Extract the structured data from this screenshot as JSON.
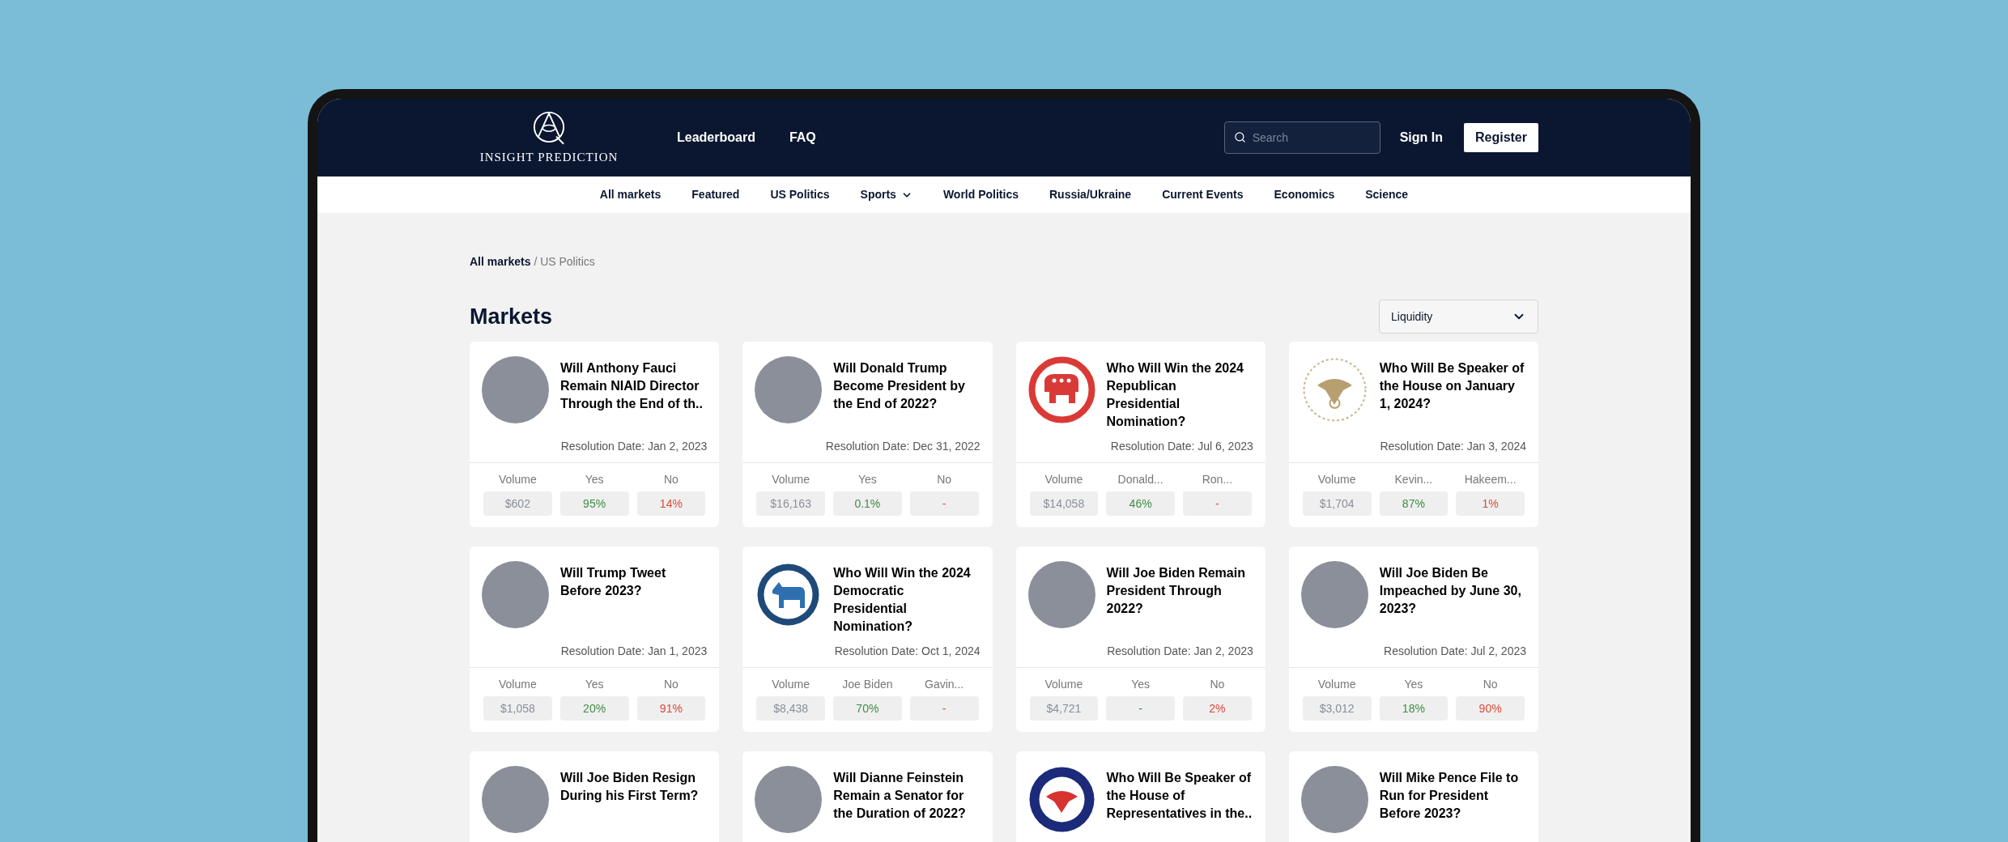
{
  "header": {
    "logo_text": "INSIGHT PREDICTION",
    "links": [
      "Leaderboard",
      "FAQ"
    ],
    "search": {
      "placeholder": "Search"
    },
    "sign_in": "Sign In",
    "register": "Register"
  },
  "nav": [
    {
      "label": "All markets",
      "dropdown": false
    },
    {
      "label": "Featured",
      "dropdown": false
    },
    {
      "label": "US Politics",
      "dropdown": false
    },
    {
      "label": "Sports",
      "dropdown": true
    },
    {
      "label": "World Politics",
      "dropdown": false
    },
    {
      "label": "Russia/Ukraine",
      "dropdown": false
    },
    {
      "label": "Current Events",
      "dropdown": false
    },
    {
      "label": "Economics",
      "dropdown": false
    },
    {
      "label": "Science",
      "dropdown": false
    }
  ],
  "breadcrumb": {
    "parent": "All markets",
    "current": "/ US Politics"
  },
  "title": "Markets",
  "sort": {
    "value": "Liquidity"
  },
  "markets": [
    {
      "kind": "photo",
      "title": "Will Anthony Fauci Remain NIAID Director Through the End of th..",
      "resolution": "Resolution Date: Jan 2, 2023",
      "stats": [
        {
          "label": "Volume",
          "value": "$602"
        },
        {
          "label": "Yes",
          "value": "95%"
        },
        {
          "label": "No",
          "value": "14%"
        }
      ]
    },
    {
      "kind": "photo",
      "title": "Will Donald Trump Become President by the End of 2022?",
      "resolution": "Resolution Date: Dec 31, 2022",
      "stats": [
        {
          "label": "Volume",
          "value": "$16,163"
        },
        {
          "label": "Yes",
          "value": "0.1%"
        },
        {
          "label": "No",
          "value": "-"
        }
      ]
    },
    {
      "kind": "elephant",
      "title": "Who Will Win the 2024 Republican Presidential Nomination?",
      "resolution": "Resolution Date: Jul 6, 2023",
      "stats": [
        {
          "label": "Volume",
          "value": "$14,058"
        },
        {
          "label": "Donald...",
          "value": "46%"
        },
        {
          "label": "Ron...",
          "value": "-"
        }
      ]
    },
    {
      "kind": "seal",
      "title": "Who Will Be Speaker of the House on January 1, 2024?",
      "resolution": "Resolution Date: Jan 3, 2024",
      "stats": [
        {
          "label": "Volume",
          "value": "$1,704"
        },
        {
          "label": "Kevin...",
          "value": "87%"
        },
        {
          "label": "Hakeem...",
          "value": "1%"
        }
      ]
    },
    {
      "kind": "photo",
      "title": "Will Trump Tweet Before 2023?",
      "resolution": "Resolution Date: Jan 1, 2023",
      "stats": [
        {
          "label": "Volume",
          "value": "$1,058"
        },
        {
          "label": "Yes",
          "value": "20%"
        },
        {
          "label": "No",
          "value": "91%"
        }
      ]
    },
    {
      "kind": "donkey",
      "title": "Who Will Win the 2024 Democratic Presidential Nomination?",
      "resolution": "Resolution Date: Oct 1, 2024",
      "stats": [
        {
          "label": "Volume",
          "value": "$8,438"
        },
        {
          "label": "Joe Biden",
          "value": "70%"
        },
        {
          "label": "Gavin...",
          "value": "-"
        }
      ]
    },
    {
      "kind": "photo",
      "title": "Will Joe Biden Remain President Through 2022?",
      "resolution": "Resolution Date: Jan 2, 2023",
      "stats": [
        {
          "label": "Volume",
          "value": "$4,721"
        },
        {
          "label": "Yes",
          "value": "-"
        },
        {
          "label": "No",
          "value": "2%"
        }
      ]
    },
    {
      "kind": "photo",
      "title": "Will Joe Biden Be Impeached by June 30, 2023?",
      "resolution": "Resolution Date: Jul 2, 2023",
      "stats": [
        {
          "label": "Volume",
          "value": "$3,012"
        },
        {
          "label": "Yes",
          "value": "18%"
        },
        {
          "label": "No",
          "value": "90%"
        }
      ]
    },
    {
      "kind": "photo",
      "title": "Will Joe Biden Resign During his First Term?"
    },
    {
      "kind": "photo",
      "title": "Will Dianne Feinstein Remain a Senator for the Duration of 2022?"
    },
    {
      "kind": "blue-seal",
      "title": "Who Will Be Speaker of the House of Representatives in the.."
    },
    {
      "kind": "photo",
      "title": "Will Mike Pence File to Run for President Before 2023?"
    }
  ]
}
